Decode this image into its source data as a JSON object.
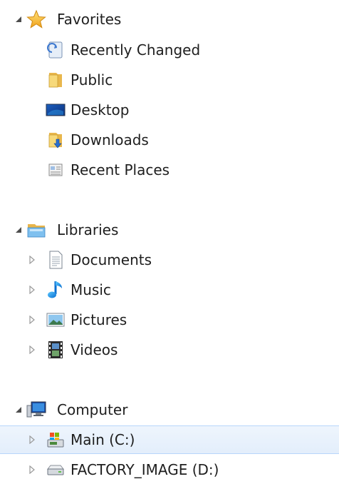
{
  "favorites": {
    "label": "Favorites",
    "items": [
      {
        "label": "Recently Changed",
        "icon": "recently-changed-icon"
      },
      {
        "label": "Public",
        "icon": "folder-icon"
      },
      {
        "label": "Desktop",
        "icon": "desktop-icon"
      },
      {
        "label": "Downloads",
        "icon": "downloads-folder-icon"
      },
      {
        "label": "Recent Places",
        "icon": "recent-places-icon"
      }
    ]
  },
  "libraries": {
    "label": "Libraries",
    "items": [
      {
        "label": "Documents",
        "icon": "documents-icon"
      },
      {
        "label": "Music",
        "icon": "music-note-icon"
      },
      {
        "label": "Pictures",
        "icon": "pictures-icon"
      },
      {
        "label": "Videos",
        "icon": "videos-icon"
      }
    ]
  },
  "computer": {
    "label": "Computer",
    "items": [
      {
        "label": "Main (C:)",
        "icon": "system-drive-icon",
        "selected": true
      },
      {
        "label": "FACTORY_IMAGE (D:)",
        "icon": "hard-drive-icon",
        "selected": false
      }
    ]
  },
  "colors": {
    "selection_background": "#e5effb",
    "selection_border": "#b8d6fb",
    "expand_arrow": "#4d4d4d",
    "collapse_arrow": "#9a9a9a"
  }
}
